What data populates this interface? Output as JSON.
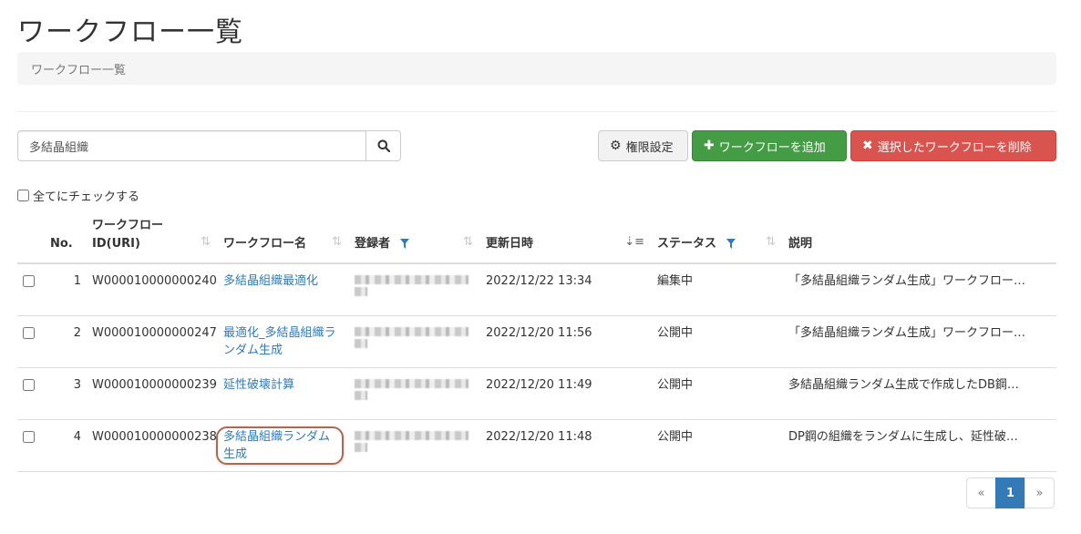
{
  "page": {
    "title": "ワークフロー一覧",
    "breadcrumb": "ワークフロー一覧"
  },
  "search": {
    "value": "多結晶組織",
    "icon": "search-icon"
  },
  "toolbar": {
    "permission_label": "権限設定",
    "add_label": "ワークフローを追加",
    "delete_label": "選択したワークフローを削除",
    "colors": {
      "success": "#449d44",
      "danger": "#d9534f",
      "primary": "#337ab7"
    }
  },
  "check_all_label": "全てにチェックする",
  "table": {
    "headers": {
      "no": "No.",
      "id_line1": "ワークフロー",
      "id_line2": "ID(URI)",
      "name": "ワークフロー名",
      "owner": "登録者",
      "updated": "更新日時",
      "status": "ステータス",
      "desc": "説明"
    },
    "rows": [
      {
        "no": "1",
        "id": "W000010000000240",
        "name": "多結晶組織最適化",
        "updated": "2022/12/22 13:34",
        "status": "編集中",
        "desc": "「多結晶組織ランダム生成」ワークフロー…"
      },
      {
        "no": "2",
        "id": "W000010000000247",
        "name": "最適化_多結晶組織ランダム生成",
        "updated": "2022/12/20 11:56",
        "status": "公開中",
        "desc": "「多結晶組織ランダム生成」ワークフロー…"
      },
      {
        "no": "3",
        "id": "W000010000000239",
        "name": "延性破壊計算",
        "updated": "2022/12/20 11:49",
        "status": "公開中",
        "desc": "多結晶組織ランダム生成で作成したDB鋼…"
      },
      {
        "no": "4",
        "id": "W000010000000238",
        "name": "多結晶組織ランダム生成",
        "updated": "2022/12/20 11:48",
        "status": "公開中",
        "desc": "DP鋼の組織をランダムに生成し、延性破…"
      }
    ]
  },
  "pagination": {
    "prev": "«",
    "current": "1",
    "next": "»"
  }
}
